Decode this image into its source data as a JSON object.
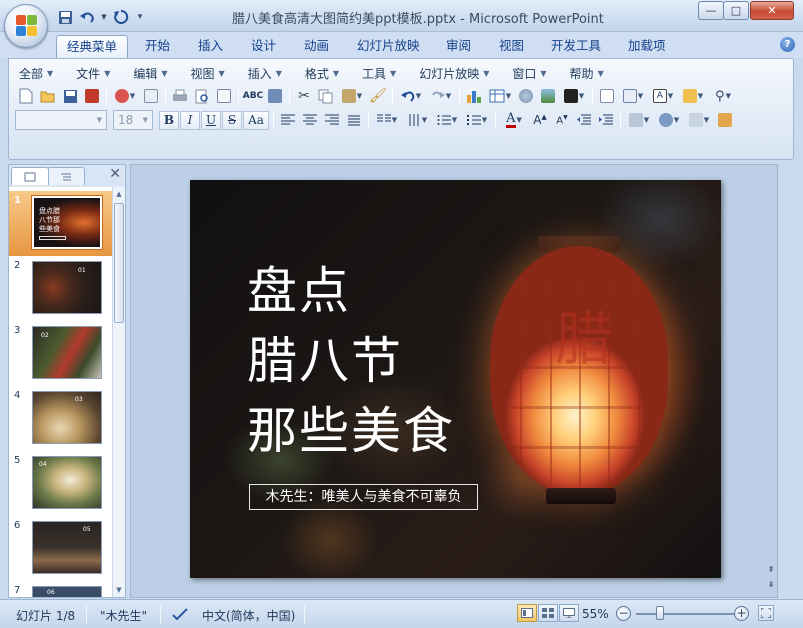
{
  "window": {
    "title": "腊八美食高清大图简约美ppt模板.pptx - Microsoft PowerPoint",
    "controls": {
      "minimize": "—",
      "maximize": "□",
      "close": "✕"
    }
  },
  "quick_access": [
    {
      "name": "save-icon"
    },
    {
      "name": "undo-icon"
    },
    {
      "name": "redo-icon"
    },
    {
      "name": "customize-icon"
    }
  ],
  "ribbon_tabs": [
    "经典菜单",
    "开始",
    "插入",
    "设计",
    "动画",
    "幻灯片放映",
    "审阅",
    "视图",
    "开发工具",
    "加载项"
  ],
  "active_tab": "经典菜单",
  "help_label": "?",
  "menus": [
    "全部",
    "文件",
    "编辑",
    "视图",
    "插入",
    "格式",
    "工具",
    "幻灯片放映",
    "窗口",
    "帮助"
  ],
  "format": {
    "font_size": "18",
    "bold": "B",
    "italic": "I",
    "underline": "U",
    "strike": "S",
    "case": "Aa",
    "font_color": "A"
  },
  "left_pane": {
    "close_label": "✕",
    "slides": [
      {
        "num": "1",
        "label": "盘点腊八节那些美食"
      },
      {
        "num": "2",
        "label": "01"
      },
      {
        "num": "3",
        "label": "02"
      },
      {
        "num": "4",
        "label": "03"
      },
      {
        "num": "5",
        "label": "04"
      },
      {
        "num": "6",
        "label": "05"
      },
      {
        "num": "7",
        "label": "06"
      }
    ],
    "selected": 1
  },
  "slide": {
    "title_lines": [
      "盘点",
      "腊八节",
      "那些美食"
    ],
    "subtitle": "木先生：唯美人与美食不可辜负",
    "lantern_glyph": "腊"
  },
  "status": {
    "slide_info": "幻灯片 1/8",
    "theme": "\"木先生\"",
    "language": "中文(简体，中国)",
    "zoom": "55%",
    "zoom_minus": "−",
    "zoom_plus": "+"
  },
  "colors": {
    "ribbon_blue": "#cfdef2",
    "selected_thumb": "#f0ad5c",
    "slide_text": "#ffffff"
  }
}
